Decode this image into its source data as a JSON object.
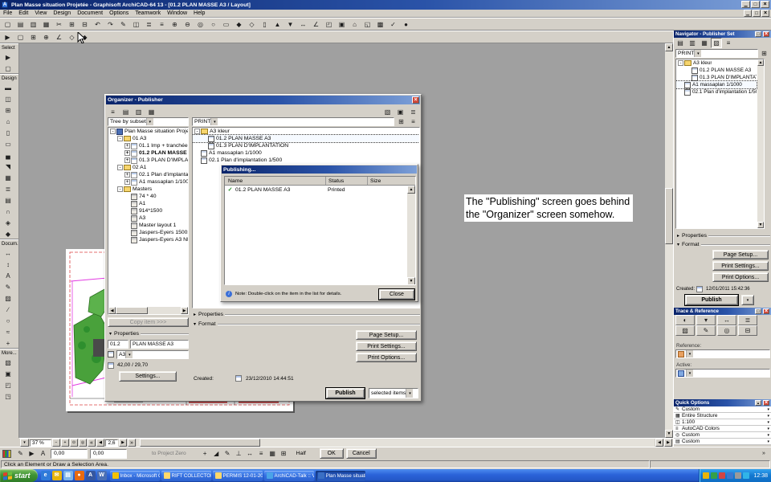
{
  "colors": {
    "titlebar_start": "#0a246a",
    "titlebar_end": "#7da0d8",
    "chrome": "#d4d0c8",
    "canvas_gray": "#a0a0a0",
    "taskbar_blue": "#2a62d8",
    "start_green": "#3f9434",
    "annotation_bg": "#ffffff",
    "check_green": "#1f8a1f",
    "close_red": "#cf483a"
  },
  "window": {
    "title": "Plan Masse situation Projetée - Graphisoft ArchiCAD-64 13 - [01.2 PLAN MASSE A3 / Layout]"
  },
  "menu": {
    "items": [
      "File",
      "Edit",
      "View",
      "Design",
      "Document",
      "Options",
      "Teamwork",
      "Window",
      "Help"
    ]
  },
  "toolbar_main": {
    "icons": [
      {
        "name": "new-icon",
        "glyph": "▢"
      },
      {
        "name": "open-icon",
        "glyph": "▤"
      },
      {
        "name": "save-icon",
        "glyph": "▥"
      },
      {
        "name": "print-icon",
        "glyph": "▦"
      },
      {
        "name": "cut-icon",
        "glyph": "✂"
      },
      {
        "name": "copy-icon",
        "glyph": "⊞"
      },
      {
        "name": "paste-icon",
        "glyph": "⊟"
      },
      {
        "name": "undo-icon",
        "glyph": "↶"
      },
      {
        "name": "redo-icon",
        "glyph": "↷"
      },
      {
        "name": "pen-icon",
        "glyph": "✎"
      },
      {
        "name": "eraser-icon",
        "glyph": "◫"
      },
      {
        "name": "layers-icon",
        "glyph": "≣"
      },
      {
        "name": "pen-set-icon",
        "glyph": "≡"
      },
      {
        "name": "zoom-in-icon",
        "glyph": "⊕"
      },
      {
        "name": "zoom-out-icon",
        "glyph": "⊖"
      },
      {
        "name": "fit-view-icon",
        "glyph": "◎"
      },
      {
        "name": "orbit-icon",
        "glyph": "○"
      },
      {
        "name": "marquee-icon",
        "glyph": "▭"
      },
      {
        "name": "element-icon",
        "glyph": "◆"
      },
      {
        "name": "group-icon",
        "glyph": "◇"
      },
      {
        "name": "column-guide-icon",
        "glyph": "▯"
      },
      {
        "name": "bring-forward-icon",
        "glyph": "▲"
      },
      {
        "name": "send-back-icon",
        "glyph": "▼"
      },
      {
        "name": "dimension-icon",
        "glyph": "↔"
      },
      {
        "name": "angle-icon",
        "glyph": "∠"
      },
      {
        "name": "section-icon",
        "glyph": "◰"
      },
      {
        "name": "camera-icon",
        "glyph": "▣"
      },
      {
        "name": "3d-window-icon",
        "glyph": "⌂"
      },
      {
        "name": "story-icon",
        "glyph": "◱"
      },
      {
        "name": "grid-icon",
        "glyph": "▩"
      },
      {
        "name": "check-icon",
        "glyph": "✓"
      },
      {
        "name": "record-icon",
        "glyph": "●"
      }
    ]
  },
  "toolbar_second": {
    "icons": [
      {
        "name": "arrow-mode-icon",
        "glyph": "▶"
      },
      {
        "name": "marquee-mode-icon",
        "glyph": "▢"
      },
      {
        "name": "grid-snap-icon",
        "glyph": "⊞"
      },
      {
        "name": "gravity-icon",
        "glyph": "⊕"
      },
      {
        "name": "guide-lines-icon",
        "glyph": "∠"
      },
      {
        "name": "snap-points-icon",
        "glyph": "◇"
      },
      {
        "name": "cursor-snap-icon",
        "glyph": "◆"
      }
    ]
  },
  "toolbox": {
    "sections": [
      {
        "label": "Select",
        "tools": [
          {
            "name": "arrow-tool-icon",
            "glyph": "▶"
          },
          {
            "name": "marquee-tool-icon",
            "glyph": "▢"
          }
        ]
      },
      {
        "label": "Design",
        "tools": [
          {
            "name": "wall-tool-icon",
            "glyph": "▬"
          },
          {
            "name": "door-tool-icon",
            "glyph": "◫"
          },
          {
            "name": "window-tool-icon",
            "glyph": "⊞"
          },
          {
            "name": "object-tool-icon",
            "glyph": "⌂"
          },
          {
            "name": "column-tool-icon",
            "glyph": "▯"
          },
          {
            "name": "beam-tool-icon",
            "glyph": "▭"
          },
          {
            "name": "slab-tool-icon",
            "glyph": "▄"
          },
          {
            "name": "roof-tool-icon",
            "glyph": "◥"
          },
          {
            "name": "mesh-tool-icon",
            "glyph": "▦"
          },
          {
            "name": "stair-tool-icon",
            "glyph": "≣"
          },
          {
            "name": "curtain-wall-tool-icon",
            "glyph": "▤"
          },
          {
            "name": "shell-tool-icon",
            "glyph": "∩"
          },
          {
            "name": "skylight-tool-icon",
            "glyph": "◈"
          },
          {
            "name": "morph-tool-icon",
            "glyph": "◆"
          }
        ]
      },
      {
        "label": "Docum.",
        "tools": [
          {
            "name": "dimension-tool-icon",
            "glyph": "↔"
          },
          {
            "name": "level-dimension-tool-icon",
            "glyph": "↕"
          },
          {
            "name": "text-tool-icon",
            "glyph": "A"
          },
          {
            "name": "label-tool-icon",
            "glyph": "✎"
          },
          {
            "name": "fill-tool-icon",
            "glyph": "▨"
          },
          {
            "name": "line-tool-icon",
            "glyph": "∕"
          },
          {
            "name": "arc-tool-icon",
            "glyph": "○"
          },
          {
            "name": "spline-tool-icon",
            "glyph": "≈"
          },
          {
            "name": "hotspot-tool-icon",
            "glyph": "+"
          }
        ]
      },
      {
        "label": "More...",
        "tools": [
          {
            "name": "figure-tool-icon",
            "glyph": "▧"
          },
          {
            "name": "drawing-tool-icon",
            "glyph": "▣"
          },
          {
            "name": "section-marker-tool-icon",
            "glyph": "◰"
          },
          {
            "name": "detail-tool-icon",
            "glyph": "◳"
          }
        ]
      }
    ]
  },
  "canvas": {
    "zoom_value": "37 %",
    "pager_value": "2,6"
  },
  "organizer": {
    "title": "Organizer - Publisher",
    "toolbar_left": [
      {
        "name": "organizer-chooser-icon",
        "glyph": "≡"
      },
      {
        "name": "organizer-project-map-icon",
        "glyph": "▤"
      },
      {
        "name": "organizer-view-map-icon",
        "glyph": "▥"
      },
      {
        "name": "organizer-layout-book-icon",
        "glyph": "▦"
      }
    ],
    "toolbar_right": [
      {
        "name": "organizer-publisher-icon",
        "glyph": "▧"
      },
      {
        "name": "organizer-properties-icon",
        "glyph": "▣"
      },
      {
        "name": "organizer-settings-icon",
        "glyph": "≣"
      }
    ],
    "left": {
      "mode": "Tree by subset",
      "tree": [
        {
          "label": "Plan Masse situation Projetée",
          "indent": 0,
          "icon": "book",
          "exp": "-"
        },
        {
          "label": "01 A3",
          "indent": 1,
          "icon": "folder",
          "exp": "-"
        },
        {
          "label": "01.1 Imp + tranchée t...",
          "indent": 2,
          "icon": "layout",
          "exp": "+"
        },
        {
          "label": "01.2 PLAN MASSE A3",
          "indent": 2,
          "icon": "layout",
          "exp": "+",
          "bold": true
        },
        {
          "label": "01.3 PLAN D'IMPLANTATION",
          "indent": 2,
          "icon": "layout",
          "exp": "+"
        },
        {
          "label": "02 A1",
          "indent": 1,
          "icon": "folder",
          "exp": "-"
        },
        {
          "label": "02.1 Plan d'implantation 1/500",
          "indent": 2,
          "icon": "layout",
          "exp": "+"
        },
        {
          "label": "A1 massaplan 1/1000",
          "indent": 2,
          "icon": "layout",
          "exp": "+"
        },
        {
          "label": "Masters",
          "indent": 1,
          "icon": "folder",
          "exp": "-"
        },
        {
          "label": "74 * 40",
          "indent": 2,
          "icon": "master"
        },
        {
          "label": "A1",
          "indent": 2,
          "icon": "master"
        },
        {
          "label": "914*1500",
          "indent": 2,
          "icon": "master"
        },
        {
          "label": "A3",
          "indent": 2,
          "icon": "master"
        },
        {
          "label": "Master layout 1",
          "indent": 2,
          "icon": "master"
        },
        {
          "label": "Jaspers-Eyers 1500x9...",
          "indent": 2,
          "icon": "master"
        },
        {
          "label": "Jaspers-Eyers A3 NL H...",
          "indent": 2,
          "icon": "master"
        }
      ],
      "copy_button": "Copy item >>>",
      "properties_label": "Properties",
      "id_value": "01.2",
      "name_value": "PLAN MASSE A3",
      "size_name": "A3",
      "dimensions": "42,00 / 29,70",
      "settings_button": "Settings..."
    },
    "right": {
      "set_name": "PRINT",
      "tree": [
        {
          "label": "A3 kleur",
          "indent": 0,
          "icon": "folder",
          "exp": "-"
        },
        {
          "label": "01.2 PLAN MASSE A3",
          "indent": 1,
          "icon": "page",
          "selected": true
        },
        {
          "label": "01.3 PLAN D'IMPLANTATION",
          "indent": 1,
          "icon": "page"
        },
        {
          "label": "A1 massaplan 1/1000",
          "indent": 0,
          "icon": "page"
        },
        {
          "label": "02.1 Plan d'implantation 1/500",
          "indent": 0,
          "icon": "page"
        }
      ],
      "properties_label": "Properties",
      "format_label": "Format",
      "page_setup_button": "Page Setup...",
      "print_settings_button": "Print Settings...",
      "print_options_button": "Print Options...",
      "created_label": "Created:",
      "created_value": "23/12/2010 14:44:51",
      "publish_button": "Publish",
      "publish_scope": "selected items"
    }
  },
  "publishing": {
    "title": "Publishing...",
    "columns": [
      "Name",
      "Status",
      "Size"
    ],
    "rows": [
      {
        "check": "✓",
        "name": "01.2 PLAN MASSE A3",
        "status": "Printed",
        "size": ""
      }
    ],
    "note": "Note: Double-click on the item in the list for details.",
    "close_button": "Close"
  },
  "annotation": {
    "text": "The \"Publishing\" screen goes behind the \"Organizer\" screen somehow."
  },
  "navigator": {
    "title": "Navigator - Publisher Set",
    "toolbar": [
      {
        "name": "navigator-project-map-icon",
        "glyph": "▤"
      },
      {
        "name": "navigator-view-map-icon",
        "glyph": "▥"
      },
      {
        "name": "navigator-layout-book-icon",
        "glyph": "▦"
      },
      {
        "name": "navigator-publisher-icon",
        "glyph": "▧",
        "active": true
      },
      {
        "name": "navigator-chooser-icon",
        "glyph": "≡"
      }
    ],
    "set_name": "PRINT",
    "tree": [
      {
        "label": "A3 kleur",
        "indent": 0,
        "icon": "folder",
        "exp": "-"
      },
      {
        "label": "01.2 PLAN MASSE A3",
        "indent": 1,
        "icon": "page"
      },
      {
        "label": "01.3 PLAN D'IMPLANTATION",
        "indent": 1,
        "icon": "page"
      },
      {
        "label": "A1 massaplan 1/1000",
        "indent": 0,
        "icon": "page",
        "selected": true
      },
      {
        "label": "02.1 Plan d'implantation 1/500",
        "indent": 0,
        "icon": "page"
      }
    ],
    "properties_label": "Properties",
    "format_label": "Format",
    "page_setup_button": "Page Setup...",
    "print_settings_button": "Print Settings...",
    "print_options_button": "Print Options...",
    "created_label": "Created:",
    "created_value": "12/01/2011 15:42:36",
    "publish_button": "Publish"
  },
  "trace": {
    "title": "Trace & Reference",
    "row1": [
      {
        "name": "trace-toggle-icon",
        "glyph": "◐"
      },
      {
        "name": "trace-pick-icon",
        "glyph": "▾"
      },
      {
        "name": "trace-move-icon",
        "glyph": "↔"
      },
      {
        "name": "trace-settings-icon",
        "glyph": "≣"
      }
    ],
    "row2": [
      {
        "name": "trace-fill-icon",
        "glyph": "▨"
      },
      {
        "name": "trace-pen-icon",
        "glyph": "✎"
      },
      {
        "name": "trace-visibility-icon",
        "glyph": "◎"
      },
      {
        "name": "trace-splitter-icon",
        "glyph": "⊟"
      }
    ],
    "reference_label": "Reference:",
    "active_label": "Active:"
  },
  "quick_options": {
    "title": "Quick Options",
    "items": [
      {
        "name": "quick-option-layer-combination",
        "glyph": "✎",
        "label": "Custom"
      },
      {
        "name": "quick-option-structure-display",
        "glyph": "▦",
        "label": "Entire Structure"
      },
      {
        "name": "quick-option-scale",
        "glyph": "◫",
        "label": "1:100"
      },
      {
        "name": "quick-option-pen-set",
        "glyph": "≡",
        "label": "AutoCAD Colors"
      },
      {
        "name": "quick-option-model-view",
        "glyph": "◎",
        "label": "Custom"
      },
      {
        "name": "quick-option-dimensions",
        "glyph": "▤",
        "label": "Custom"
      }
    ]
  },
  "coordbar": {
    "icons_left": [
      {
        "name": "pen-sets-icon",
        "glyph": "✎"
      },
      {
        "name": "arrow-info-icon",
        "glyph": "▶"
      },
      {
        "name": "text-style-icon",
        "glyph": "A"
      }
    ],
    "x_value": "0,00",
    "y_value": "0,00",
    "gravity_label": "to Project Zero",
    "icons_mid": [
      {
        "name": "add-vertex-icon",
        "glyph": "+"
      },
      {
        "name": "slope-icon",
        "glyph": "◢"
      },
      {
        "name": "magic-wand-icon",
        "glyph": "✎"
      },
      {
        "name": "perpendicular-icon",
        "glyph": "⊥"
      },
      {
        "name": "offset-icon",
        "glyph": "↔"
      },
      {
        "name": "rows-icon",
        "glyph": "≡"
      },
      {
        "name": "mesh-snap-icon",
        "glyph": "▦"
      },
      {
        "name": "grid-lock-icon",
        "glyph": "⊞"
      }
    ],
    "half_label": "Half",
    "ok_button": "OK",
    "cancel_button": "Cancel"
  },
  "statusbar": {
    "message": "Click an Element or Draw a Selection Area."
  },
  "taskbar": {
    "start_label": "start",
    "quick_launch": [
      {
        "name": "ie-quicklaunch-icon",
        "color": "#2f7ad9",
        "glyph": "e"
      },
      {
        "name": "outlook-quicklaunch-icon",
        "color": "#e8b40a",
        "glyph": "✉"
      },
      {
        "name": "show-desktop-icon",
        "color": "#7db5e8",
        "glyph": "▤"
      },
      {
        "name": "media-player-icon",
        "color": "#e86a10",
        "glyph": "●"
      },
      {
        "name": "archicad-quicklaunch-icon",
        "color": "#3557a0",
        "glyph": "A"
      },
      {
        "name": "word-quicklaunch-icon",
        "color": "#4a6fb5",
        "glyph": "W"
      }
    ],
    "tasks": [
      {
        "name": "task-outlook",
        "label": "Inbox - Microsoft Out...",
        "color": "#f3c200"
      },
      {
        "name": "task-rift-collectors",
        "label": "RIFT COLLECTORS E...",
        "color": "#ffd86b"
      },
      {
        "name": "task-permis",
        "label": "PERMIS 12-01-2011",
        "color": "#ffd86b"
      },
      {
        "name": "task-archicad-talk",
        "label": "ArchiCAD-Talk :: View...",
        "color": "#4aa3e8"
      },
      {
        "name": "task-plan-masse",
        "label": "Plan Masse situation ...",
        "color": "#3a6fc4",
        "active": true
      }
    ],
    "tray": [
      {
        "name": "tray-icon-1",
        "color": "#e8b40a"
      },
      {
        "name": "tray-icon-2",
        "color": "#35a048"
      },
      {
        "name": "tray-icon-3",
        "color": "#d04545"
      },
      {
        "name": "tray-icon-4",
        "color": "#3a78d0"
      },
      {
        "name": "tray-icon-5",
        "color": "#9a9a9a"
      },
      {
        "name": "tray-icon-6",
        "color": "#30b4e8"
      }
    ],
    "time": "12:38"
  }
}
